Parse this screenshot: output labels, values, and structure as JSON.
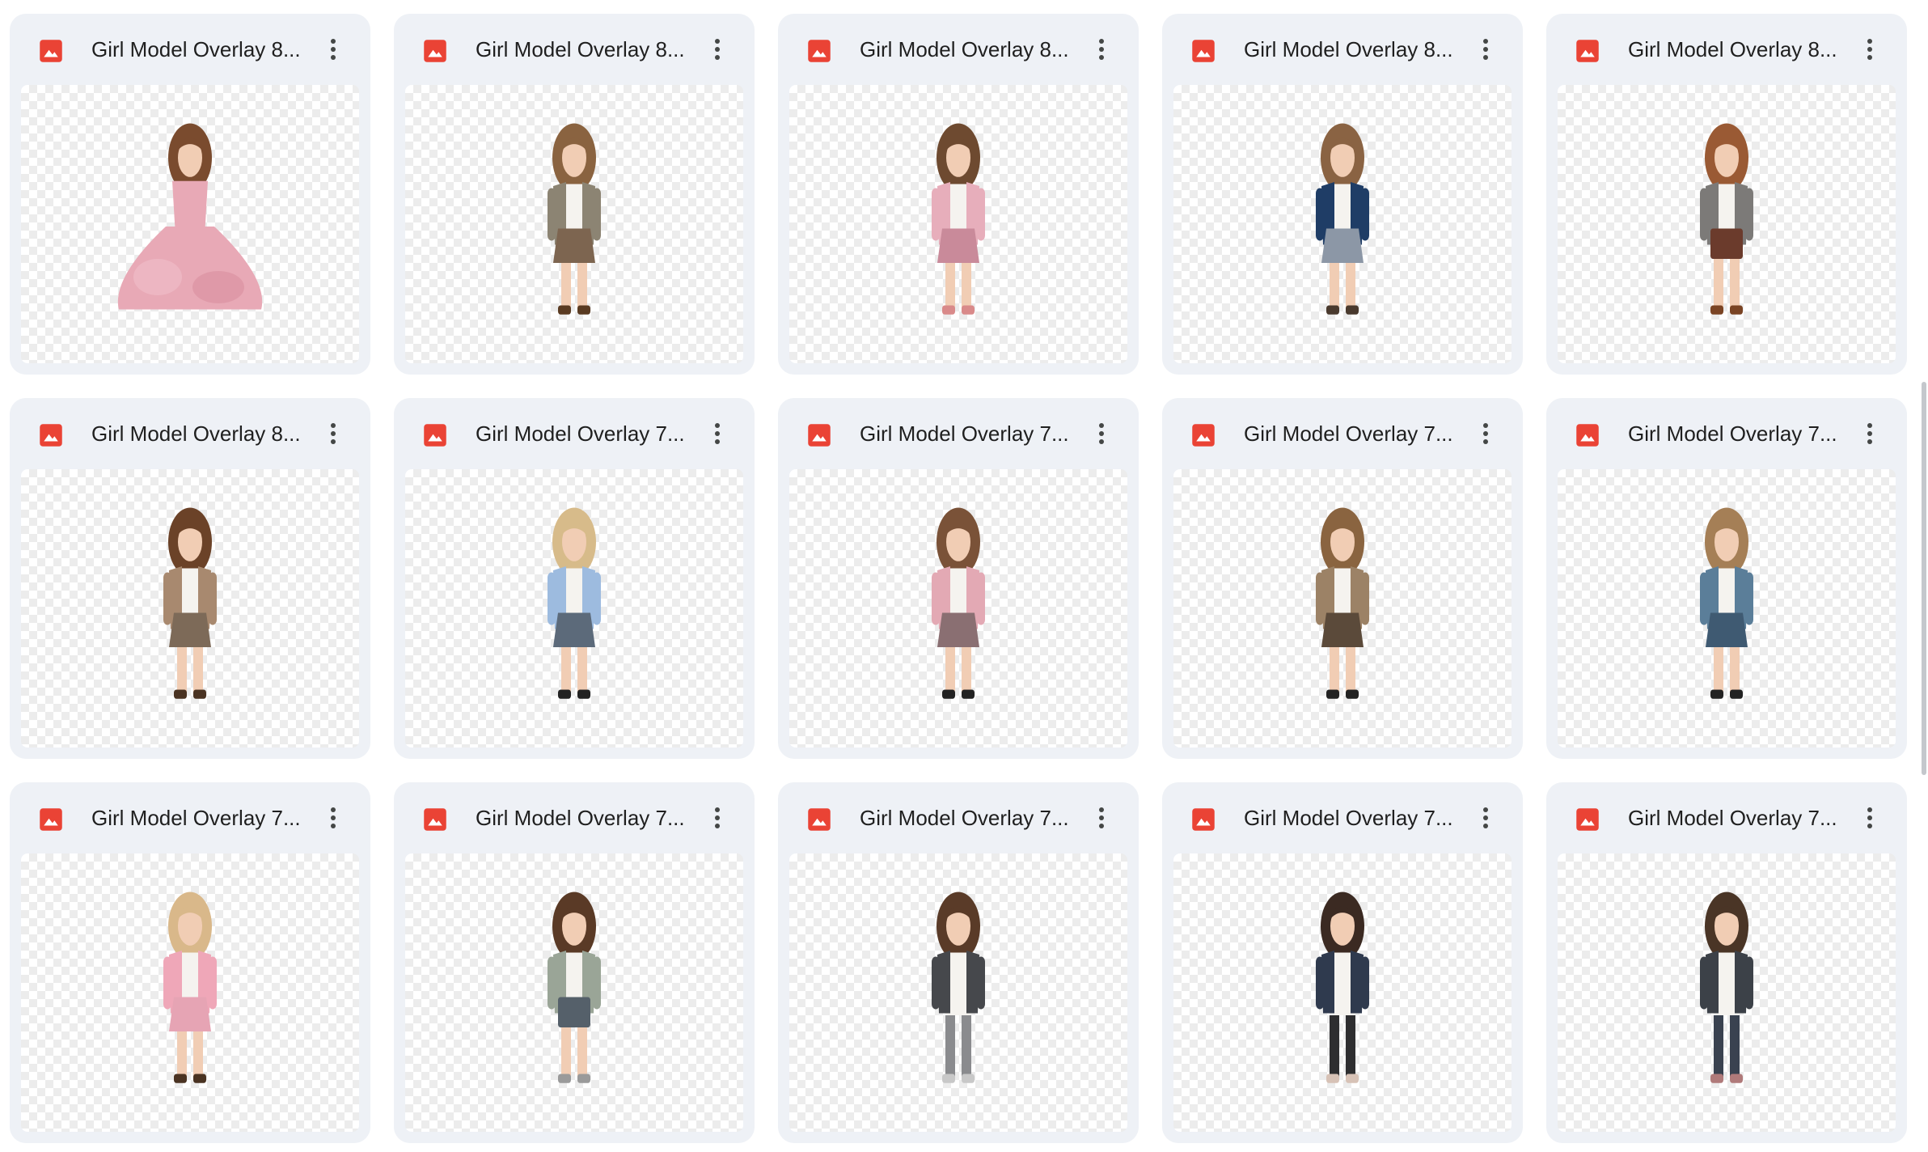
{
  "files": [
    {
      "title": "Girl Model Overlay 8...",
      "icon": "image-file-icon",
      "figure": {
        "dress": "ballgown",
        "hair": "#7a4b2e",
        "top": "#e8a9b6",
        "bottom": "#e8a9b6",
        "shoes": "#e8a9b6"
      }
    },
    {
      "title": "Girl Model Overlay 8...",
      "icon": "image-file-icon",
      "figure": {
        "dress": "skirt",
        "hair": "#8a6340",
        "top": "#8c8473",
        "bottom": "#7d6550",
        "shoes": "#5a3b22"
      }
    },
    {
      "title": "Girl Model Overlay 8...",
      "icon": "image-file-icon",
      "figure": {
        "dress": "skirt",
        "hair": "#6e4a30",
        "top": "#e7aebb",
        "bottom": "#c98a9a",
        "shoes": "#d98a8a"
      }
    },
    {
      "title": "Girl Model Overlay 8...",
      "icon": "image-file-icon",
      "figure": {
        "dress": "skirt",
        "hair": "#8a6343",
        "top": "#1f3d66",
        "bottom": "#8c97a6",
        "shoes": "#4a3a2e"
      }
    },
    {
      "title": "Girl Model Overlay 8...",
      "icon": "image-file-icon",
      "figure": {
        "dress": "shorts",
        "hair": "#9a5a34",
        "top": "#7c7a78",
        "bottom": "#6b3b2c",
        "shoes": "#7a4424"
      }
    },
    {
      "title": "Girl Model Overlay 8...",
      "icon": "image-file-icon",
      "figure": {
        "dress": "skirt",
        "hair": "#6b4228",
        "top": "#a8896f",
        "bottom": "#7d6a58",
        "shoes": "#4a3322"
      }
    },
    {
      "title": "Girl Model Overlay 7...",
      "icon": "image-file-icon",
      "figure": {
        "dress": "skirt",
        "hair": "#d7bb8a",
        "top": "#9dbbdf",
        "bottom": "#5c6a7a",
        "shoes": "#222222"
      }
    },
    {
      "title": "Girl Model Overlay 7...",
      "icon": "image-file-icon",
      "figure": {
        "dress": "skirt",
        "hair": "#7a5238",
        "top": "#e3a9b4",
        "bottom": "#8a6f72",
        "shoes": "#222222"
      }
    },
    {
      "title": "Girl Model Overlay 7...",
      "icon": "image-file-icon",
      "figure": {
        "dress": "skirt",
        "hair": "#8a6440",
        "top": "#9c8266",
        "bottom": "#5b4a3a",
        "shoes": "#222222"
      }
    },
    {
      "title": "Girl Model Overlay 7...",
      "icon": "image-file-icon",
      "figure": {
        "dress": "skirt",
        "hair": "#a57f56",
        "top": "#5b7e99",
        "bottom": "#3f5a72",
        "shoes": "#222222"
      }
    },
    {
      "title": "Girl Model Overlay 7...",
      "icon": "image-file-icon",
      "figure": {
        "dress": "skirt",
        "hair": "#d9b88a",
        "top": "#efa7b8",
        "bottom": "#e6a4b4",
        "shoes": "#4a3322"
      }
    },
    {
      "title": "Girl Model Overlay 7...",
      "icon": "image-file-icon",
      "figure": {
        "dress": "shorts",
        "hair": "#5a3a26",
        "top": "#9aa597",
        "bottom": "#55606a",
        "shoes": "#9a9a9a"
      }
    },
    {
      "title": "Girl Model Overlay 7...",
      "icon": "image-file-icon",
      "figure": {
        "dress": "pants",
        "hair": "#5a3b28",
        "top": "#46484c",
        "bottom": "#8a8b8e",
        "shoes": "#c8c8c8"
      }
    },
    {
      "title": "Girl Model Overlay 7...",
      "icon": "image-file-icon",
      "figure": {
        "dress": "pants",
        "hair": "#3b2a22",
        "top": "#2f3a4e",
        "bottom": "#2e2e30",
        "shoes": "#d7c2b6"
      }
    },
    {
      "title": "Girl Model Overlay 7...",
      "icon": "image-file-icon",
      "figure": {
        "dress": "pants",
        "hair": "#4a3526",
        "top": "#3c4148",
        "bottom": "#3a4250",
        "shoes": "#b07a7a"
      }
    }
  ],
  "colors": {
    "card_bg": "#eef1f6",
    "icon_red": "#ea4335",
    "title_text": "#1f1f1f",
    "skin": "#f1cdb4",
    "shirt": "#f5f3ef"
  }
}
